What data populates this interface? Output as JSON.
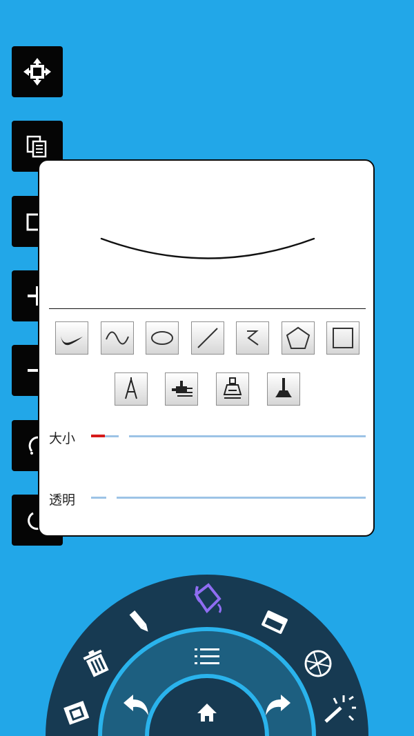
{
  "side_buttons": [
    {
      "name": "move-button",
      "icon": "move-arrows-icon"
    },
    {
      "name": "copy-button",
      "icon": "copy-pages-icon"
    },
    {
      "name": "crop-button",
      "icon": "crop-icon"
    },
    {
      "name": "zoom-in-button",
      "icon": "plus-icon"
    },
    {
      "name": "zoom-out-button",
      "icon": "minus-icon"
    },
    {
      "name": "rotate-left-button",
      "icon": "rotate-icon"
    },
    {
      "name": "rotate-right-button",
      "icon": "rotate-icon"
    }
  ],
  "brush_panel": {
    "shape_tools": [
      "calligraphy-stroke-icon",
      "sine-curve-icon",
      "ellipse-icon",
      "straight-line-icon",
      "zigzag-icon",
      "pentagon-icon",
      "rectangle-icon"
    ],
    "pen_tools": [
      "compass-pen-icon",
      "spray-nozzle-icon",
      "stamp-icon",
      "brush-icon"
    ],
    "size": {
      "label": "大小",
      "value": 0.05
    },
    "opacity": {
      "label": "透明",
      "value": 0.0
    }
  },
  "radial_menu": {
    "outer": [
      "book-icon",
      "trash-icon",
      "pencil-icon",
      "paint-bucket-icon",
      "eraser-icon",
      "color-wheel-icon",
      "magic-wand-icon"
    ],
    "inner": [
      "undo-icon",
      "menu-list-icon",
      "redo-icon"
    ],
    "center": "home-icon",
    "colors": {
      "outer": "#173a52",
      "ring": "#2ab3ec",
      "inner": "#1d5f80",
      "active": "#8f6df2"
    }
  }
}
